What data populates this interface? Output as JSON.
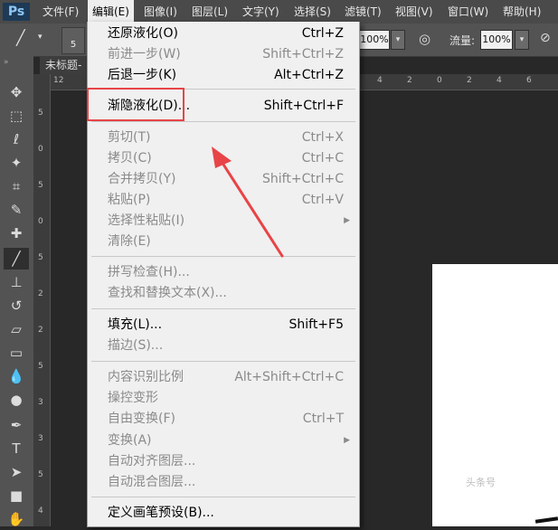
{
  "app": {
    "logo": "Ps"
  },
  "menubar": [
    {
      "label": "文件(F)",
      "active": false
    },
    {
      "label": "编辑(E)",
      "active": true
    },
    {
      "label": "图像(I)",
      "active": false
    },
    {
      "label": "图层(L)",
      "active": false
    },
    {
      "label": "文字(Y)",
      "active": false
    },
    {
      "label": "选择(S)",
      "active": false
    },
    {
      "label": "滤镜(T)",
      "active": false
    },
    {
      "label": "视图(V)",
      "active": false
    },
    {
      "label": "窗口(W)",
      "active": false
    },
    {
      "label": "帮助(H)",
      "active": false
    }
  ],
  "options_bar": {
    "brush_size": "5",
    "opacity_value": "100%",
    "flow_label": "流量:",
    "flow_value": "100%"
  },
  "document": {
    "tab_title": "未标题-",
    "ruler_h": [
      "12",
      "4",
      "2",
      "0",
      "2",
      "4",
      "6",
      "8",
      "10"
    ],
    "ruler_v": [
      "5",
      "0",
      "5",
      "0",
      "5",
      "2",
      "2",
      "5",
      "3",
      "3",
      "5",
      "4",
      "5"
    ]
  },
  "edit_menu": {
    "items": [
      {
        "label": "还原液化(O)",
        "shortcut": "Ctrl+Z",
        "enabled": true
      },
      {
        "label": "前进一步(W)",
        "shortcut": "Shift+Ctrl+Z",
        "enabled": false
      },
      {
        "label": "后退一步(K)",
        "shortcut": "Alt+Ctrl+Z",
        "enabled": true
      },
      {
        "label": "渐隐液化(D)...",
        "shortcut": "Shift+Ctrl+F",
        "enabled": true
      },
      {
        "label": "剪切(T)",
        "shortcut": "Ctrl+X",
        "enabled": false
      },
      {
        "label": "拷贝(C)",
        "shortcut": "Ctrl+C",
        "enabled": false
      },
      {
        "label": "合并拷贝(Y)",
        "shortcut": "Shift+Ctrl+C",
        "enabled": false
      },
      {
        "label": "粘贴(P)",
        "shortcut": "Ctrl+V",
        "enabled": false
      },
      {
        "label": "选择性粘贴(I)",
        "shortcut": "",
        "enabled": false,
        "submenu": true
      },
      {
        "label": "清除(E)",
        "shortcut": "",
        "enabled": false
      },
      {
        "label": "拼写检查(H)...",
        "shortcut": "",
        "enabled": false
      },
      {
        "label": "查找和替换文本(X)...",
        "shortcut": "",
        "enabled": false
      },
      {
        "label": "填充(L)...",
        "shortcut": "Shift+F5",
        "enabled": true
      },
      {
        "label": "描边(S)...",
        "shortcut": "",
        "enabled": false
      },
      {
        "label": "内容识别比例",
        "shortcut": "Alt+Shift+Ctrl+C",
        "enabled": false
      },
      {
        "label": "操控变形",
        "shortcut": "",
        "enabled": false
      },
      {
        "label": "自由变换(F)",
        "shortcut": "Ctrl+T",
        "enabled": false
      },
      {
        "label": "变换(A)",
        "shortcut": "",
        "enabled": false,
        "submenu": true
      },
      {
        "label": "自动对齐图层...",
        "shortcut": "",
        "enabled": false
      },
      {
        "label": "自动混合图层...",
        "shortcut": "",
        "enabled": false
      },
      {
        "label": "定义画笔预设(B)...",
        "shortcut": "",
        "enabled": true
      }
    ]
  },
  "annotation": {
    "highlight_color": "#e84447"
  },
  "watermark": {
    "text": "头条号"
  }
}
